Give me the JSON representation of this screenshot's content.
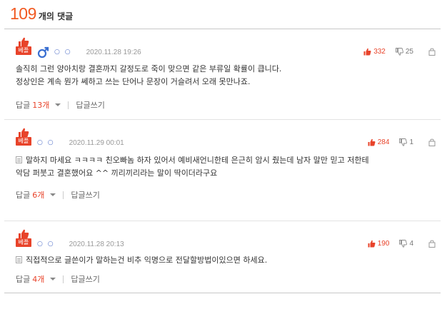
{
  "header": {
    "count": "109",
    "suffix": "개의 댓글"
  },
  "comments": [
    {
      "badge": "베플",
      "has_gender_icon": true,
      "dots": "○ ○",
      "date": "2020.11.28 19:26",
      "up": "332",
      "down": "25",
      "lines": [
        "솔직히 그런 양아치랑 결혼까지 갈정도로 죽이 맞으면 같은 부류일 확률이 큽니다.",
        "정상인은 계속 뭔가 쎄하고 쓰는 단어나 문장이 거슬려서 오래 못만나죠."
      ],
      "reply_label": "답글",
      "reply_count": "13개",
      "write_label": "답글쓰기"
    },
    {
      "badge": "베플",
      "has_gender_icon": false,
      "dots": "○ ○",
      "date": "2020.11.29 00:01",
      "up": "284",
      "down": "1",
      "lines": [
        "말하지 마세요 ㅋㅋㅋㅋ 친오빠놈 하자 있어서 예비새언니한테 은근히 암시 줬는데 남자 말만 믿고 저한테",
        "악담 퍼붓고 결혼했어요 ^^ 끼리끼리라는 말이 딱이더라구요"
      ],
      "reply_label": "답글",
      "reply_count": "6개",
      "write_label": "답글쓰기"
    },
    {
      "badge": "베플",
      "has_gender_icon": false,
      "dots": "○ ○",
      "date": "2020.11.28 20:13",
      "up": "190",
      "down": "4",
      "lines": [
        "직접적으로 글쓴이가 말하는건 비추 익명으로 전달할방법이있으면 하세요."
      ],
      "reply_label": "답글",
      "reply_count": "4개",
      "write_label": "답글쓰기"
    }
  ],
  "colors": {
    "accent": "#f15a22",
    "best": "#e8432a",
    "dots": "#4f6ec7"
  },
  "icons": [
    "thumb-up-icon",
    "male-icon",
    "vote-up-icon",
    "vote-down-icon",
    "lock-icon",
    "document-icon",
    "caret-down-icon"
  ]
}
